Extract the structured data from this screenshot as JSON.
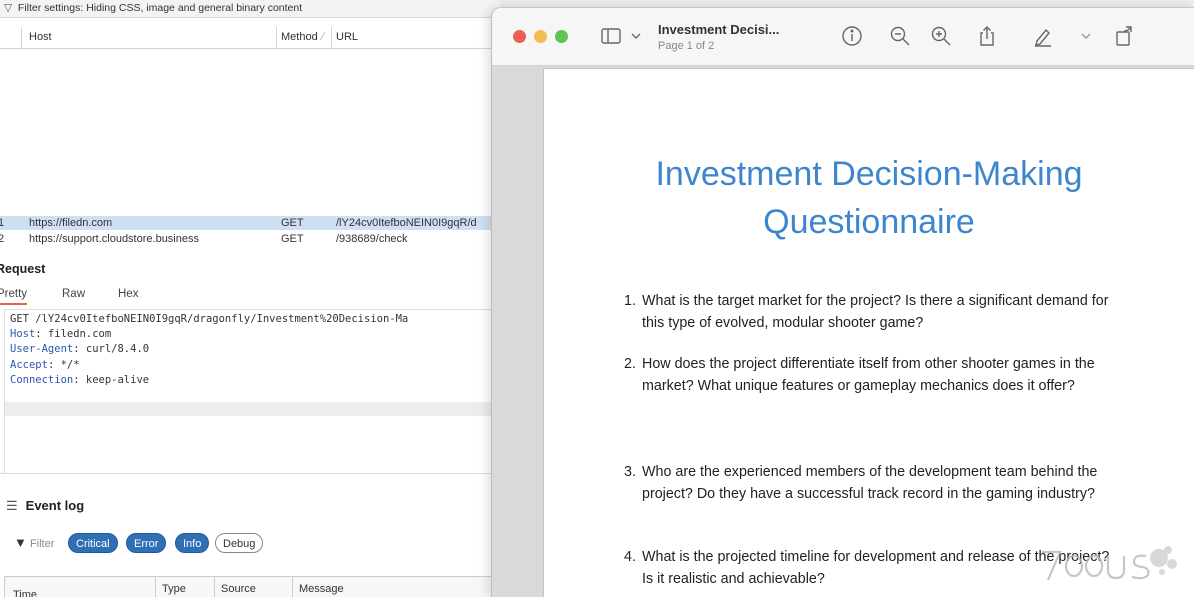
{
  "proxy": {
    "filter_text": "Filter settings: Hiding CSS, image and general binary content",
    "columns": {
      "host": "Host",
      "method": "Method",
      "url": "URL"
    },
    "rows": [
      {
        "num": "1",
        "host": "https://filedn.com",
        "method": "GET",
        "url": "/lY24cv0ItefboNEIN0I9gqR/d"
      },
      {
        "num": "2",
        "host": "https://support.cloudstore.business",
        "method": "GET",
        "url": "/938689/check"
      }
    ],
    "request_title": "Request",
    "tabs": [
      "Pretty",
      "Raw",
      "Hex"
    ],
    "request_lines": [
      {
        "key": "",
        "value": "GET /lY24cv0ItefboNEIN0I9gqR/dragonfly/Investment%20Decision-Ma"
      },
      {
        "key": "Host",
        "value": " filedn.com"
      },
      {
        "key": "User-Agent",
        "value": " curl/8.4.0"
      },
      {
        "key": "Accept",
        "value": " */*"
      },
      {
        "key": "Connection",
        "value": " keep-alive"
      }
    ],
    "event_log": {
      "title": "Event log",
      "filter_label": "Filter",
      "filters": [
        {
          "label": "Critical",
          "active": true
        },
        {
          "label": "Error",
          "active": true
        },
        {
          "label": "Info",
          "active": true
        },
        {
          "label": "Debug",
          "active": false
        }
      ],
      "columns": [
        "Time",
        "Type",
        "Source",
        "Message"
      ]
    }
  },
  "preview": {
    "title": "Investment Decisi...",
    "subtitle": "Page 1 of 2",
    "toolbar_icons": [
      "sidebar-icon",
      "chevron-down-icon",
      "info-icon",
      "zoom-out-icon",
      "zoom-in-icon",
      "share-icon",
      "markup-icon",
      "chevron-down-icon",
      "rotate-icon"
    ],
    "document": {
      "heading_line1": "Investment Decision-Making",
      "heading_line2": "Questionnaire",
      "questions": [
        {
          "num": "1.",
          "text": "What is the target market for the project? Is there a significant demand for this type of evolved, modular shooter game?"
        },
        {
          "num": "2.",
          "text": "How does the project differentiate itself from other shooter games in the market? What unique features or gameplay mechanics does it offer?"
        },
        {
          "num": "3.",
          "text": "Who are the experienced members of the development team behind the project? Do they have a successful track record in the gaming industry?"
        },
        {
          "num": "4.",
          "text": "What is the projected timeline for development and release of the project? Is it realistic and achievable?"
        }
      ]
    },
    "colors": {
      "heading": "#3d86cf",
      "close": "#ec5f57",
      "minimize": "#f4bd4f",
      "zoom": "#5fc453"
    }
  }
}
